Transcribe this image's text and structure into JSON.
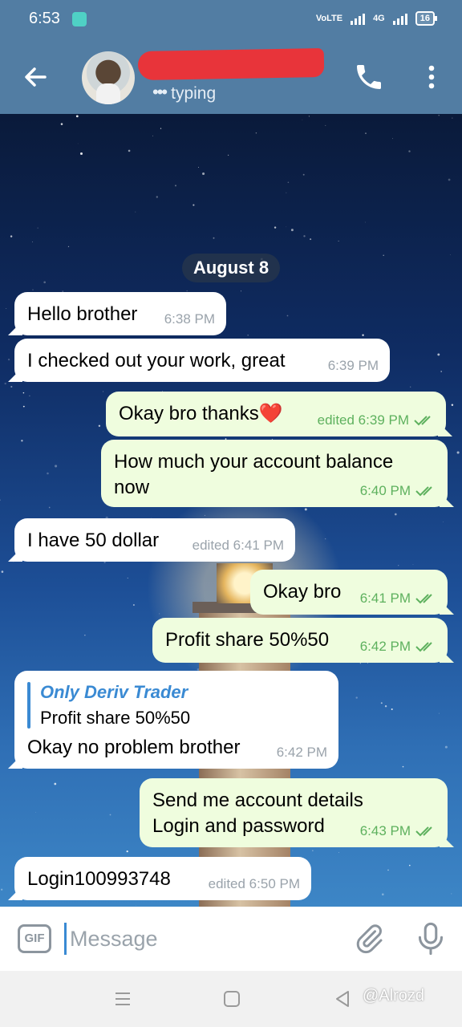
{
  "status_bar": {
    "time": "6:53",
    "network_label": "VoLTE",
    "network_type": "4G",
    "battery": "16"
  },
  "header": {
    "status": "typing",
    "back_icon": "arrow-left-icon",
    "call_icon": "phone-icon",
    "menu_icon": "more-vertical-icon"
  },
  "chat": {
    "date": "August 8",
    "messages": [
      {
        "dir": "in",
        "text": "Hello brother",
        "time": "6:38 PM"
      },
      {
        "dir": "in",
        "text": "I checked out your work, great",
        "time": "6:39 PM"
      },
      {
        "dir": "out",
        "text": "Okay bro thanks❤️",
        "time": "edited 6:39 PM"
      },
      {
        "dir": "out",
        "text_line1": "How much your account balance",
        "text_line2": "now",
        "time": "6:40 PM"
      },
      {
        "dir": "in",
        "text": "I have 50 dollar",
        "time": "edited 6:41 PM"
      },
      {
        "dir": "out",
        "text": "Okay bro",
        "time": "6:41 PM"
      },
      {
        "dir": "out",
        "text": "Profit share 50%50",
        "time": "6:42 PM"
      },
      {
        "dir": "in",
        "reply_name": "Only Deriv Trader",
        "reply_text": "Profit share 50%50",
        "text": "Okay no problem brother",
        "time": "6:42 PM"
      },
      {
        "dir": "out",
        "text_line1": "Send me account details",
        "text_line2": "Login and password",
        "time": "6:43 PM"
      },
      {
        "dir": "in",
        "text": "Login100993748",
        "time": "edited 6:50 PM"
      }
    ]
  },
  "input": {
    "placeholder": "Message",
    "gif_label": "GIF"
  },
  "watermark": "@Alrozd",
  "colors": {
    "header": "#527da3",
    "incoming_bubble": "#ffffff",
    "outgoing_bubble": "#effdde",
    "outgoing_meta": "#5eb15e",
    "reply_accent": "#3a8ad3"
  }
}
